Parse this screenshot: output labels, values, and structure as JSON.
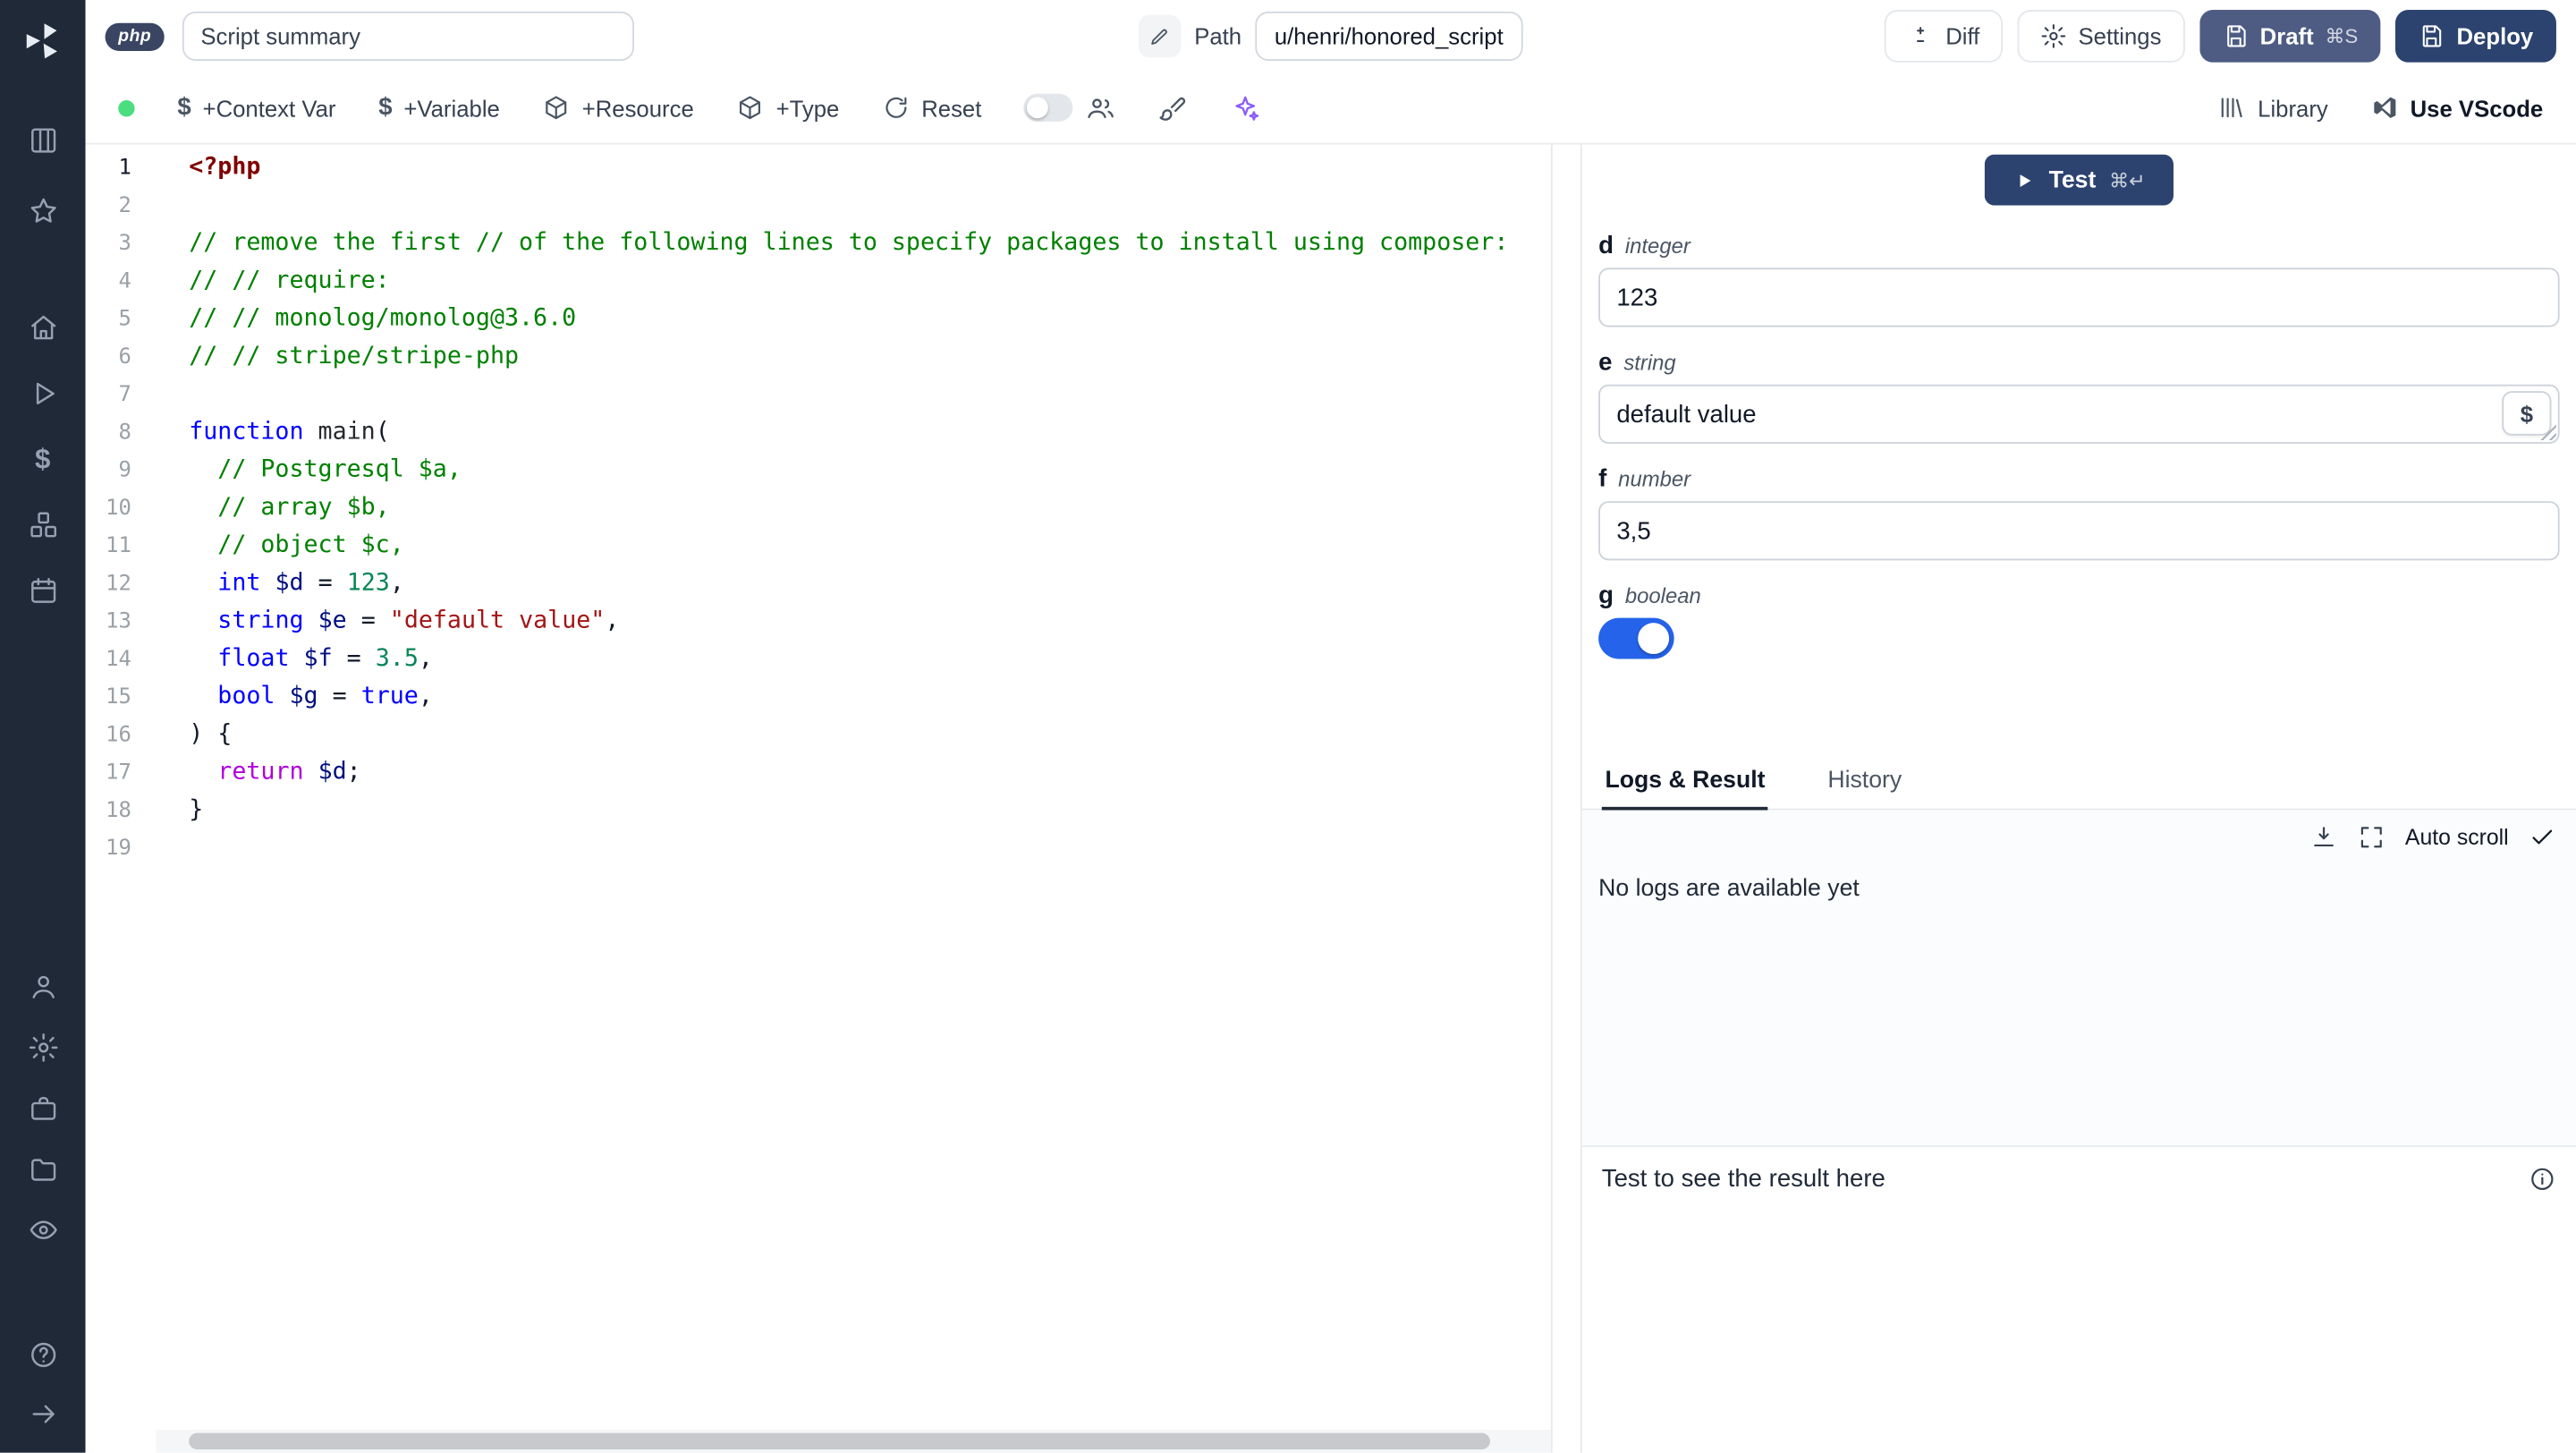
{
  "colors": {
    "sidebar_bg": "#1f2937",
    "status_dot": "#4ade80",
    "sparkles": "#8b5cf6",
    "draft_button": "#4e5c84",
    "deploy_button": "#2c4370",
    "test_button": "#2c4370",
    "toggle_on": "#2563eb"
  },
  "header": {
    "language_badge": "php",
    "summary_value": "Script summary",
    "path_label": "Path",
    "path_value": "u/henri/honored_script",
    "diff_button": "Diff",
    "settings_button": "Settings",
    "draft_button": "Draft",
    "draft_shortcut": "⌘S",
    "deploy_button": "Deploy"
  },
  "toolbar": {
    "add_context_var": "+Context Var",
    "add_variable": "+Variable",
    "add_resource": "+Resource",
    "add_type": "+Type",
    "reset": "Reset",
    "library": "Library",
    "use_vscode": "Use VScode"
  },
  "sidebar": {
    "icons": [
      "windmill-logo",
      "columns",
      "star",
      "home",
      "play",
      "dollar",
      "boxes",
      "calendar",
      "user",
      "gear",
      "briefcase",
      "folder",
      "eye",
      "help",
      "arrow-right"
    ]
  },
  "editor": {
    "language": "php",
    "lines": [
      {
        "n": "1",
        "active": true,
        "tokens": [
          [
            "php",
            "<?php"
          ]
        ]
      },
      {
        "n": "2",
        "tokens": []
      },
      {
        "n": "3",
        "tokens": [
          [
            "cm",
            "// remove the first // of the following lines to specify packages to install using composer:"
          ]
        ]
      },
      {
        "n": "4",
        "tokens": [
          [
            "cm",
            "// // require:"
          ]
        ]
      },
      {
        "n": "5",
        "tokens": [
          [
            "cm",
            "// // monolog/monolog@3.6.0"
          ]
        ]
      },
      {
        "n": "6",
        "tokens": [
          [
            "cm",
            "// // stripe/stripe-php"
          ]
        ]
      },
      {
        "n": "7",
        "tokens": []
      },
      {
        "n": "8",
        "tokens": [
          [
            "kw",
            "function"
          ],
          [
            "pl",
            " "
          ],
          [
            "fn",
            "main"
          ],
          [
            "pl",
            "("
          ]
        ]
      },
      {
        "n": "9",
        "tokens": [
          [
            "cm",
            "  // Postgresql $a,"
          ]
        ]
      },
      {
        "n": "10",
        "tokens": [
          [
            "cm",
            "  // array $b,"
          ]
        ]
      },
      {
        "n": "11",
        "tokens": [
          [
            "cm",
            "  // object $c,"
          ]
        ]
      },
      {
        "n": "12",
        "tokens": [
          [
            "pl",
            "  "
          ],
          [
            "kw",
            "int"
          ],
          [
            "pl",
            " "
          ],
          [
            "vr",
            "$d"
          ],
          [
            "pl",
            " = "
          ],
          [
            "nm",
            "123"
          ],
          [
            "pl",
            ","
          ]
        ]
      },
      {
        "n": "13",
        "tokens": [
          [
            "pl",
            "  "
          ],
          [
            "kw",
            "string"
          ],
          [
            "pl",
            " "
          ],
          [
            "vr",
            "$e"
          ],
          [
            "pl",
            " = "
          ],
          [
            "st",
            "\"default value\""
          ],
          [
            "pl",
            ","
          ]
        ]
      },
      {
        "n": "14",
        "tokens": [
          [
            "pl",
            "  "
          ],
          [
            "kw",
            "float"
          ],
          [
            "pl",
            " "
          ],
          [
            "vr",
            "$f"
          ],
          [
            "pl",
            " = "
          ],
          [
            "nm",
            "3.5"
          ],
          [
            "pl",
            ","
          ]
        ]
      },
      {
        "n": "15",
        "tokens": [
          [
            "pl",
            "  "
          ],
          [
            "kw",
            "bool"
          ],
          [
            "pl",
            " "
          ],
          [
            "vr",
            "$g"
          ],
          [
            "pl",
            " = "
          ],
          [
            "kw",
            "true"
          ],
          [
            "pl",
            ","
          ]
        ]
      },
      {
        "n": "16",
        "tokens": [
          [
            "pl",
            ") {"
          ]
        ]
      },
      {
        "n": "17",
        "tokens": [
          [
            "pl",
            "  "
          ],
          [
            "rt",
            "return"
          ],
          [
            "pl",
            " "
          ],
          [
            "vr",
            "$d"
          ],
          [
            "pl",
            ";"
          ]
        ]
      },
      {
        "n": "18",
        "tokens": [
          [
            "pl",
            "}"
          ]
        ]
      },
      {
        "n": "19",
        "tokens": []
      }
    ]
  },
  "panel": {
    "test_button": "Test",
    "test_shortcut": "⌘↵",
    "fields": [
      {
        "name": "d",
        "type": "integer",
        "value": "123"
      },
      {
        "name": "e",
        "type": "string",
        "value": "default value",
        "suffix_button": "$"
      },
      {
        "name": "f",
        "type": "number",
        "value": "3,5"
      },
      {
        "name": "g",
        "type": "boolean",
        "value": true
      }
    ],
    "tabs": [
      {
        "label": "Logs & Result",
        "active": true
      },
      {
        "label": "History",
        "active": false
      }
    ],
    "auto_scroll": "Auto scroll",
    "no_logs_message": "No logs are available yet",
    "result_placeholder": "Test to see the result here"
  }
}
